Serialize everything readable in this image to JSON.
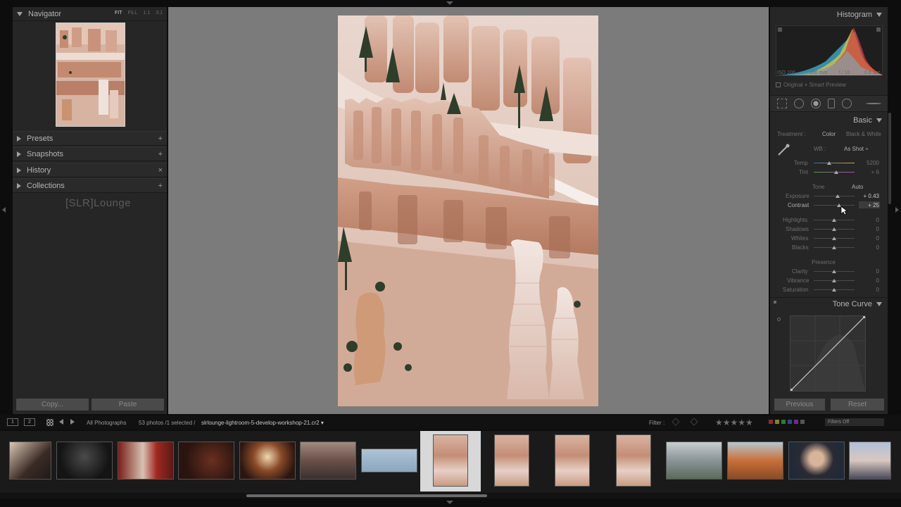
{
  "navigator": {
    "title": "Navigator",
    "zoom_options": [
      "FIT",
      "FILL",
      "1:1",
      "3:1"
    ]
  },
  "left_sections": [
    {
      "label": "Presets",
      "action": "+"
    },
    {
      "label": "Snapshots",
      "action": "+"
    },
    {
      "label": "History",
      "action": "×"
    },
    {
      "label": "Collections",
      "action": "+"
    }
  ],
  "watermark": "[SLR]Lounge",
  "left_buttons": {
    "copy": "Copy...",
    "paste": "Paste"
  },
  "histogram": {
    "title": "Histogram",
    "iso": "ISO 100",
    "focal": "180 mm",
    "aperture": "f / 10",
    "shutter": "0.6 sec",
    "preview_label": "Original + Smart Preview"
  },
  "basic": {
    "title": "Basic",
    "treatment_label": "Treatment :",
    "treatment_color": "Color",
    "treatment_bw": "Black & White",
    "wb_label": "WB :",
    "wb_value": "As Shot ÷",
    "temp": {
      "label": "Temp",
      "value": "5200",
      "level": 0.38
    },
    "tint": {
      "label": "Tint",
      "value": "+ 6",
      "level": 0.55
    },
    "tone_label": "Tone",
    "auto_label": "Auto",
    "exposure": {
      "label": "Exposure",
      "value": "+ 0.43",
      "level": 0.58
    },
    "contrast": {
      "label": "Contrast",
      "value": "+ 25",
      "level": 0.62
    },
    "highlights": {
      "label": "Highlights",
      "value": "0",
      "level": 0.5
    },
    "shadows": {
      "label": "Shadows",
      "value": "0",
      "level": 0.5
    },
    "whites": {
      "label": "Whites",
      "value": "0",
      "level": 0.5
    },
    "blacks": {
      "label": "Blacks",
      "value": "0",
      "level": 0.5
    },
    "presence_label": "Presence",
    "clarity": {
      "label": "Clarity",
      "value": "0",
      "level": 0.5
    },
    "vibrance": {
      "label": "Vibrance",
      "value": "0",
      "level": 0.5
    },
    "saturation": {
      "label": "Saturation",
      "value": "0",
      "level": 0.5
    }
  },
  "tone_curve": {
    "title": "Tone Curve"
  },
  "right_buttons": {
    "previous": "Previous",
    "reset": "Reset"
  },
  "filmstrip_bar": {
    "monitor1": "1",
    "monitor2": "2",
    "source": "All Photographs",
    "count": "53 photos /1 selected /",
    "filename": "slrlounge-lightroom-5-develop-workshop-21.cr2 ▾",
    "filter_label": "Filter :",
    "stars": "★★★★★",
    "filters_off": "Filters Off"
  },
  "colors": {
    "panel": "#262626",
    "canvas": "#7b7b7b",
    "selected_cell": "#d8d8d8"
  }
}
